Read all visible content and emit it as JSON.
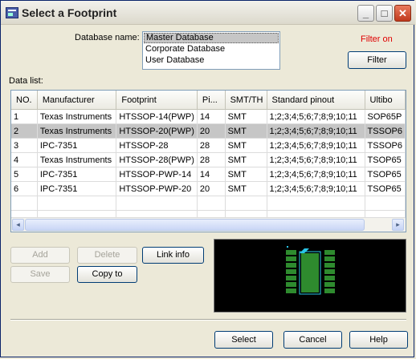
{
  "window": {
    "title": "Select a Footprint"
  },
  "titlebar": {
    "minimize": "_",
    "maximize": "□",
    "close": "✕"
  },
  "database": {
    "label": "Database name:",
    "options": [
      "Master Database",
      "Corporate Database",
      "User Database"
    ],
    "selected": "Master Database"
  },
  "filter": {
    "status": "Filter on",
    "button": "Filter"
  },
  "datalist": {
    "label": "Data list:",
    "columns": [
      "NO.",
      "Manufacturer",
      "Footprint",
      "Pi...",
      "SMT/TH",
      "Standard pinout",
      "Ultibo"
    ],
    "rows": [
      [
        "1",
        "Texas Instruments",
        "HTSSOP-14(PWP)",
        "14",
        "SMT",
        "1;2;3;4;5;6;7;8;9;10;11",
        "SOP65P"
      ],
      [
        "2",
        "Texas Instruments",
        "HTSSOP-20(PWP)",
        "20",
        "SMT",
        "1;2;3;4;5;6;7;8;9;10;11",
        "TSSOP6"
      ],
      [
        "3",
        "IPC-7351",
        "HTSSOP-28",
        "28",
        "SMT",
        "1;2;3;4;5;6;7;8;9;10;11",
        "TSSOP6"
      ],
      [
        "4",
        "Texas Instruments",
        "HTSSOP-28(PWP)",
        "28",
        "SMT",
        "1;2;3;4;5;6;7;8;9;10;11",
        "TSOP65"
      ],
      [
        "5",
        "IPC-7351",
        "HTSSOP-PWP-14",
        "14",
        "SMT",
        "1;2;3;4;5;6;7;8;9;10;11",
        "TSOP65"
      ],
      [
        "6",
        "IPC-7351",
        "HTSSOP-PWP-20",
        "20",
        "SMT",
        "1;2;3;4;5;6;7;8;9;10;11",
        "TSOP65"
      ]
    ],
    "selected_row": 1,
    "scroll_left": "◂",
    "scroll_right": "▸"
  },
  "actions": {
    "add": "Add",
    "delete": "Delete",
    "link_info": "Link info",
    "save": "Save",
    "copy_to": "Copy to"
  },
  "footer": {
    "select": "Select",
    "cancel": "Cancel",
    "help": "Help"
  },
  "colors": {
    "selection": "#c6c6c6",
    "filter_on": "#e00000",
    "pad": "#2e8b2e",
    "body_outline": "#29c4e6"
  }
}
